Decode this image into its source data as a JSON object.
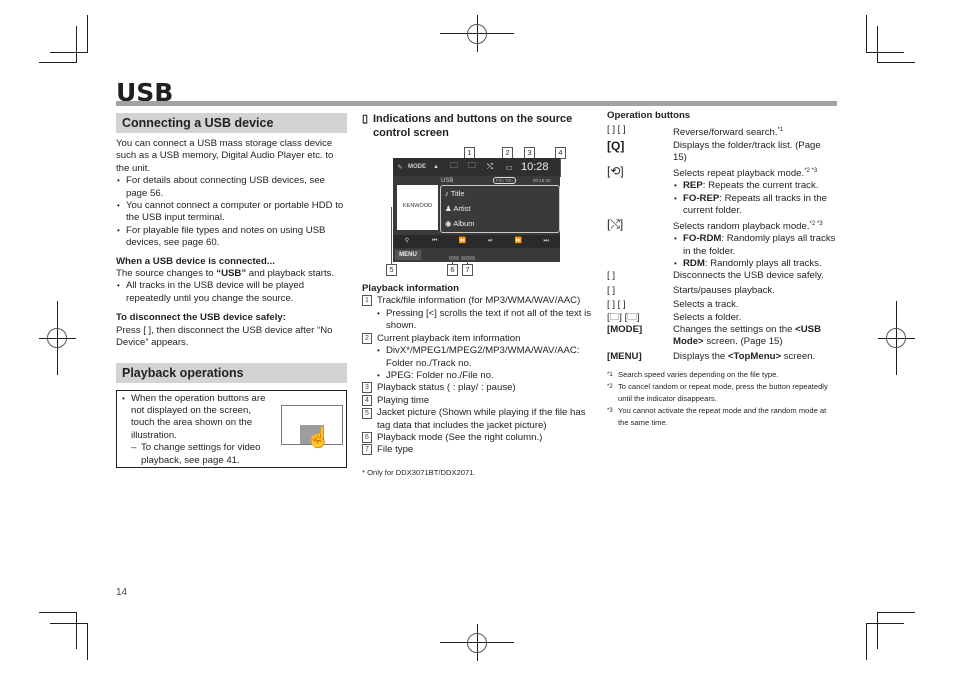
{
  "page": {
    "title": "USB",
    "page_number": "14"
  },
  "left": {
    "section1_title": "Connecting a USB device",
    "intro": "You can connect a USB mass storage class device such as a USB memory, Digital Audio Player etc. to the unit.",
    "bullets": [
      "For details about connecting USB devices, see page 56.",
      "You cannot connect a computer or portable HDD to the USB input terminal.",
      "For playable file types and notes on using USB devices, see page 60."
    ],
    "connected_heading": "When a USB device is connected...",
    "connected_text_pre": "The source changes to ",
    "connected_text_bold": "“USB”",
    "connected_text_post": " and playback starts.",
    "connected_bullet": "All tracks in the USB device will be played repeatedly until you change the source.",
    "disconnect_heading": "To disconnect the USB device safely:",
    "disconnect_text": "Press [    ], then disconnect the USB device after “No Device” appears.",
    "section2_title": "Playback operations",
    "note_bullet": "When the operation buttons are not displayed on the screen, touch the area shown on the illustration.",
    "note_dash": "To change settings for video playback, see page 41."
  },
  "middle": {
    "heading_marker": "▯",
    "heading": "Indications and buttons on the source control screen",
    "screen": {
      "top_buttons": [
        "MODE",
        "▲",
        "🗀",
        "🗀",
        "⤭",
        "▭"
      ],
      "clock": "10:28",
      "source_label": "USB",
      "item_info": "F0n   T0n",
      "play_time": "00:16:20",
      "jacket_text": "KENWOOD",
      "track_rows": [
        {
          "icon": "♪",
          "label": "Title"
        },
        {
          "icon": "♟",
          "label": "Artist"
        },
        {
          "icon": "◉",
          "label": "Album"
        }
      ],
      "control_buttons": [
        "⚲",
        "⏮",
        "⏪",
        "⏯",
        "⏩",
        "⏭"
      ],
      "menu_label": "MENU"
    },
    "callouts": [
      "1",
      "2",
      "3",
      "4",
      "5",
      "6",
      "7"
    ],
    "playback_info_heading": "Playback information",
    "items": [
      {
        "num": "1",
        "text": "Track/file information (for MP3/WMA/WAV/AAC)",
        "subs": [
          "Pressing [<] scrolls the text if not all of the text is shown."
        ]
      },
      {
        "num": "2",
        "text": "Current playback item information",
        "subs": [
          "DivX*/MPEG1/MPEG2/MP3/WMA/WAV/AAC: Folder no./Track no.",
          "JPEG: Folder no./File no."
        ]
      },
      {
        "num": "3",
        "text": "Playback status (    : play/    : pause)",
        "subs": []
      },
      {
        "num": "4",
        "text": "Playing time",
        "subs": []
      },
      {
        "num": "5",
        "text": "Jacket picture (Shown while playing if the file has tag data that includes the jacket picture)",
        "subs": []
      },
      {
        "num": "6",
        "text": "Playback mode (See the right column.)",
        "subs": []
      },
      {
        "num": "7",
        "text": "File type",
        "subs": []
      }
    ],
    "footnote": "*   Only for DDX3071BT/DDX2071."
  },
  "right": {
    "heading": "Operation buttons",
    "rows": [
      {
        "key": "[      ] [      ]",
        "desc": "Reverse/forward search.",
        "sup": "*1",
        "subs": []
      },
      {
        "key": "[Q]",
        "desc": "Displays the folder/track list. (Page 15)",
        "sup": "",
        "subs": []
      },
      {
        "key": "[⟲]",
        "desc": "Selects repeat playback mode.",
        "sup": "*2 *3",
        "subs": [
          {
            "b": "REP",
            "t": ": Repeats the current track."
          },
          {
            "b": "FO-REP",
            "t": ": Repeats all tracks in the current folder."
          }
        ]
      },
      {
        "key": "[⤭]",
        "desc": "Selects random playback mode.",
        "sup": "*2 *3",
        "subs": [
          {
            "b": "FO-RDM",
            "t": ": Randomly plays all tracks in the folder."
          },
          {
            "b": "RDM",
            "t": ": Randomly plays all tracks."
          }
        ]
      },
      {
        "key": "[   ]",
        "desc": "Disconnects the USB device safely.",
        "sup": "",
        "subs": []
      },
      {
        "key": "[      ]",
        "desc": "Starts/pauses playback.",
        "sup": "",
        "subs": []
      },
      {
        "key": "[      ] [      ]",
        "desc": "Selects a track.",
        "sup": "",
        "subs": []
      },
      {
        "key": "[🗀] [🗀]",
        "desc": "Selects a folder.",
        "sup": "",
        "subs": []
      }
    ],
    "mode_key": "[MODE]",
    "mode_desc_pre": "Changes the settings on the ",
    "mode_desc_bold": "<USB Mode>",
    "mode_desc_post": " screen. (Page 15)",
    "menu_key": "[MENU]",
    "menu_desc_pre": "Displays the ",
    "menu_desc_bold": "<TopMenu>",
    "menu_desc_post": "  screen.",
    "footnotes": [
      {
        "mark": "*1",
        "text": "Search speed varies depending on the file type."
      },
      {
        "mark": "*2",
        "text": "To cancel random or repeat mode, press the button repeatedly until the indicator disappears."
      },
      {
        "mark": "*3",
        "text": "You cannot activate the repeat mode and the random mode at the same time."
      }
    ]
  }
}
